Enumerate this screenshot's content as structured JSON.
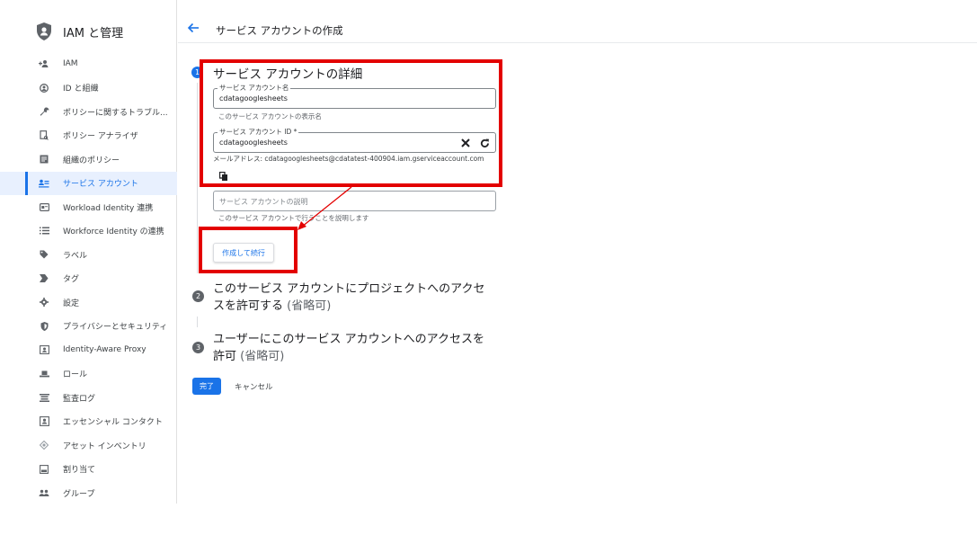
{
  "sidebar": {
    "title": "IAM と管理",
    "items": [
      {
        "label": "IAM",
        "icon": "add-person-icon"
      },
      {
        "label": "ID と組織",
        "icon": "account-circle-icon"
      },
      {
        "label": "ポリシーに関するトラブル...",
        "icon": "wrench-icon"
      },
      {
        "label": "ポリシー アナライザ",
        "icon": "document-search-icon"
      },
      {
        "label": "組織のポリシー",
        "icon": "list-document-icon"
      },
      {
        "label": "サービス アカウント",
        "icon": "service-account-icon",
        "active": true
      },
      {
        "label": "Workload Identity 連携",
        "icon": "id-card-icon"
      },
      {
        "label": "Workforce Identity の連携",
        "icon": "list-icon"
      },
      {
        "label": "ラベル",
        "icon": "tag-icon"
      },
      {
        "label": "タグ",
        "icon": "chevron-tag-icon"
      },
      {
        "label": "設定",
        "icon": "gear-icon"
      },
      {
        "label": "プライバシーとセキュリティ",
        "icon": "shield-icon"
      },
      {
        "label": "Identity-Aware Proxy",
        "icon": "proxy-icon"
      },
      {
        "label": "ロール",
        "icon": "hat-icon"
      },
      {
        "label": "監査ログ",
        "icon": "log-icon"
      },
      {
        "label": "エッセンシャル コンタクト",
        "icon": "contact-icon"
      },
      {
        "label": "アセット インベントリ",
        "icon": "diamond-icon"
      },
      {
        "label": "割り当て",
        "icon": "quota-icon"
      },
      {
        "label": "グループ",
        "icon": "group-icon"
      }
    ]
  },
  "header": {
    "title": "サービス アカウントの作成"
  },
  "steps": {
    "step1": {
      "number": "1",
      "title": "サービス アカウントの詳細",
      "name_label": "サービス アカウント名",
      "name_value": "cdatagooglesheets",
      "name_hint": "このサービス アカウントの表示名",
      "id_label": "サービス アカウント ID *",
      "id_value": "cdatagooglesheets",
      "email_line": "メールアドレス: cdatagooglesheets@cdatatest-400904.iam.gserviceaccount.com",
      "desc_placeholder": "サービス アカウントの説明",
      "desc_hint": "このサービス アカウントで行うことを説明します",
      "create_label": "作成して続行"
    },
    "step2": {
      "number": "2",
      "title_line1": "このサービス アカウントにプロジェクトへのアクセ",
      "title_line2": "スを許可する",
      "optional": "(省略可)"
    },
    "step3": {
      "number": "3",
      "title_line1": "ユーザーにこのサービス アカウントへのアクセスを",
      "title_line2": "許可",
      "optional": "(省略可)"
    }
  },
  "actions": {
    "done_label": "完了",
    "cancel_label": "キャンセル"
  },
  "colors": {
    "accent": "#1a73e8",
    "annotation": "#e30000"
  }
}
